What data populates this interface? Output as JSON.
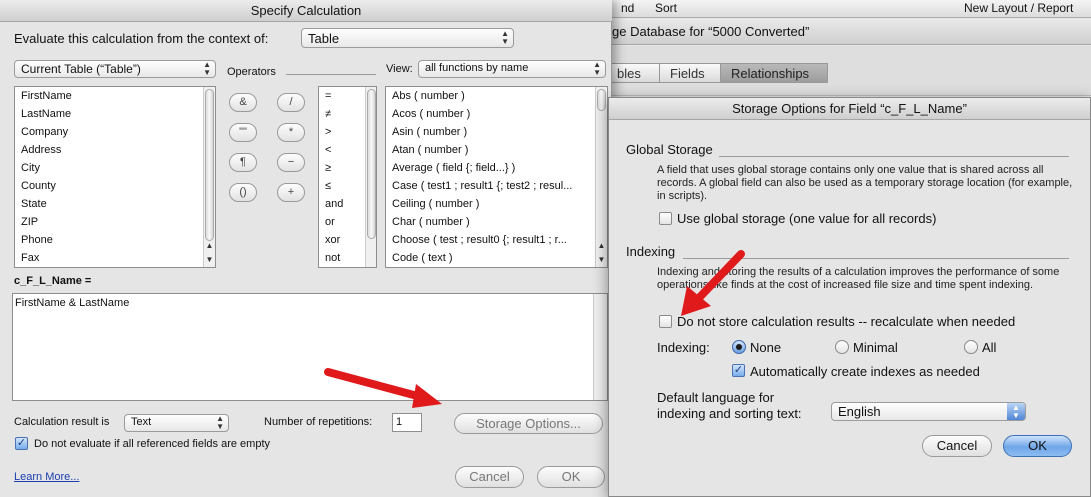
{
  "background": {
    "menu": {
      "item1": "nd",
      "item2": "Sort",
      "item3": "New Layout / Report"
    },
    "window_title": "ge Database for “5000 Converted”",
    "tabs": [
      "bles",
      "Fields",
      "Relationships"
    ]
  },
  "calc_dialog": {
    "title": "Specify Calculation",
    "context_label": "Evaluate this calculation from the context of:",
    "context_value": "Table",
    "table_popup": "Current Table (“Table”)",
    "operators_label": "Operators",
    "view_label": "View:",
    "view_value": "all functions by name",
    "fields": [
      "FirstName",
      "LastName",
      "Company",
      "Address",
      "City",
      "County",
      "State",
      "ZIP",
      "Phone",
      "Fax"
    ],
    "operator_buttons": [
      "&",
      "/",
      "\"\"",
      "*",
      "¶",
      "−",
      "()",
      "+"
    ],
    "comparison_ops": [
      "=",
      "≠",
      ">",
      "<",
      "≥",
      "≤",
      "and",
      "or",
      "xor",
      "not"
    ],
    "functions": [
      "Abs ( number )",
      "Acos ( number )",
      "Asin ( number )",
      "Atan ( number )",
      "Average ( field {; field...} )",
      "Case ( test1 ; result1 {; test2 ; resul...",
      "Ceiling ( number )",
      "Char ( number )",
      "Choose ( test ; result0 {; result1 ; r...",
      "Code ( text )"
    ],
    "field_name": "c_F_L_Name =",
    "formula": "FirstName  &  LastName",
    "result_label": "Calculation result is",
    "result_value": "Text",
    "repetitions_label": "Number of repetitions:",
    "repetitions_value": "1",
    "storage_button": "Storage Options...",
    "do_not_evaluate": "Do not evaluate if all referenced fields are empty",
    "do_not_evaluate_checked": true,
    "learn_more": "Learn More...",
    "cancel": "Cancel",
    "ok": "OK"
  },
  "storage_dialog": {
    "title": "Storage Options for Field “c_F_L_Name”",
    "global_heading": "Global Storage",
    "global_desc": "A field that uses global storage contains only one value that is shared across all records.  A global field can also be used as a temporary storage location (for example, in scripts).",
    "use_global": "Use global storage (one value for all records)",
    "use_global_checked": false,
    "indexing_heading": "Indexing",
    "indexing_desc": "Indexing and storing the results of a calculation improves the performance of some operations like finds at the cost of increased file size and time spent indexing.",
    "do_not_store": "Do not store calculation results -- recalculate when needed",
    "do_not_store_checked": false,
    "indexing_label": "Indexing:",
    "radio_none": "None",
    "radio_minimal": "Minimal",
    "radio_all": "All",
    "selected_indexing": "None",
    "auto_create": "Automatically create indexes as needed",
    "auto_create_checked": true,
    "language_label1": "Default language for",
    "language_label2": "indexing and sorting text:",
    "language_value": "English",
    "cancel": "Cancel",
    "ok": "OK"
  },
  "colors": {
    "accent": "#6fa6e8",
    "arrow": "#e0191b"
  }
}
